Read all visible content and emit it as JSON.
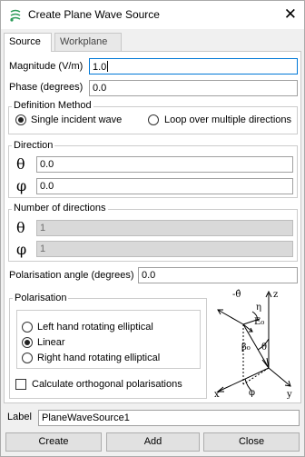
{
  "window": {
    "title": "Create Plane Wave Source",
    "close_glyph": "✕"
  },
  "tabs": [
    {
      "label": "Source",
      "active": true
    },
    {
      "label": "Workplane",
      "active": false
    }
  ],
  "magnitude": {
    "label": "Magnitude (V/m)",
    "value": "1.0"
  },
  "phase": {
    "label": "Phase (degrees)",
    "value": "0.0"
  },
  "definition_method": {
    "title": "Definition Method",
    "options": [
      {
        "label": "Single incident wave",
        "selected": true
      },
      {
        "label": "Loop over multiple directions",
        "selected": false
      }
    ]
  },
  "direction": {
    "title": "Direction",
    "theta": {
      "symbol": "θ",
      "value": "0.0"
    },
    "phi": {
      "symbol": "φ",
      "value": "0.0"
    }
  },
  "num_directions": {
    "title": "Number of directions",
    "theta": {
      "symbol": "θ",
      "value": "1"
    },
    "phi": {
      "symbol": "φ",
      "value": "1"
    }
  },
  "polarisation_angle": {
    "label": "Polarisation angle (degrees)",
    "value": "0.0"
  },
  "polarisation": {
    "title": "Polarisation",
    "options": [
      {
        "label": "Left hand rotating elliptical",
        "selected": false
      },
      {
        "label": "Linear",
        "selected": true
      },
      {
        "label": "Right hand rotating elliptical",
        "selected": false
      }
    ],
    "orthogonal": {
      "label": "Calculate orthogonal polarisations",
      "checked": false
    }
  },
  "diagram_labels": {
    "z": "z",
    "x": "x",
    "y": "y",
    "minus_theta_hat": "-θ̂",
    "eta": "η",
    "e0": "E₀",
    "beta0": "β₀",
    "theta": "θ",
    "phi": "φ"
  },
  "label_field": {
    "label": "Label",
    "value": "PlaneWaveSource1"
  },
  "buttons": {
    "create": "Create",
    "add": "Add",
    "close": "Close"
  },
  "colors": {
    "accent": "#0078d7",
    "app_icon": "#2e9c5a"
  },
  "icons": {
    "app": "plane-wave-source-icon",
    "close": "close-icon"
  }
}
